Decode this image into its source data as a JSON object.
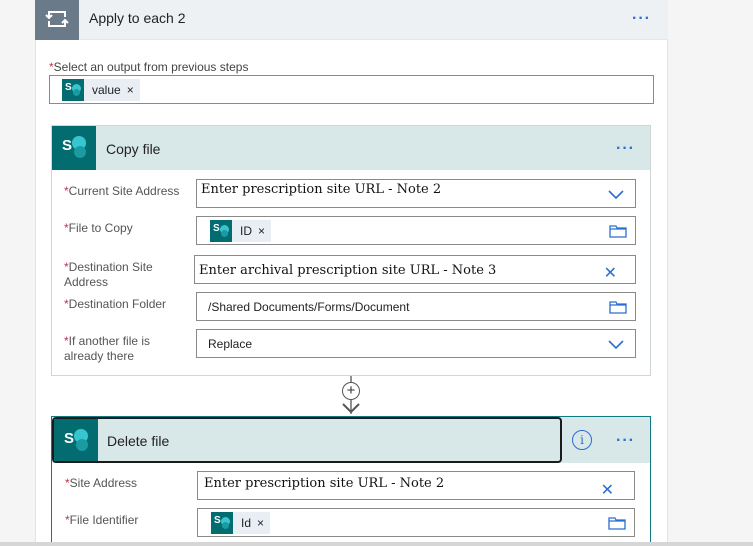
{
  "loop": {
    "title": "Apply to each 2",
    "more": "···",
    "select_label": "Select an output from previous steps",
    "token": {
      "label": "value",
      "remove": "×"
    }
  },
  "copy_file": {
    "title": "Copy file",
    "more": "···",
    "fields": {
      "current_site": {
        "label": "Current Site Address",
        "value": "Enter prescription site URL - Note 2"
      },
      "file_to_copy": {
        "label": "File to Copy",
        "token": "ID",
        "remove": "×"
      },
      "dest_site": {
        "label_line1": "Destination Site",
        "label_line2": "Address",
        "value": "Enter archival prescription site URL - Note 3"
      },
      "dest_folder": {
        "label": "Destination Folder",
        "value": "/Shared Documents/Forms/Document"
      },
      "if_exists": {
        "label_line1": "If another file is",
        "label_line2": "already there",
        "value": "Replace"
      }
    }
  },
  "connector": {
    "add": "+"
  },
  "delete_file": {
    "title": "Delete file",
    "info": "i",
    "more": "···",
    "fields": {
      "site_address": {
        "label": "Site Address",
        "value": "Enter prescription site URL - Note 2"
      },
      "file_identifier": {
        "label": "File Identifier",
        "token": "Id",
        "remove": "×"
      }
    }
  },
  "colors": {
    "sharepoint": "#036c70",
    "accent": "#2b6ed1",
    "required": "#c4314b"
  }
}
